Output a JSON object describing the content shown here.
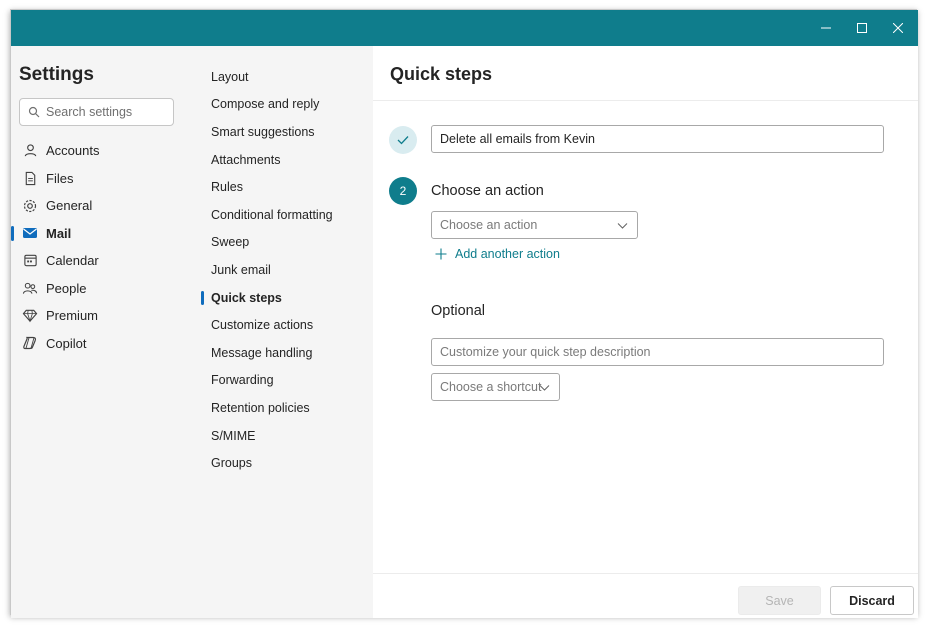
{
  "window": {
    "controls": {
      "minimize_icon": "minimize-icon",
      "maximize_icon": "maximize-icon",
      "close_icon": "close-icon"
    }
  },
  "settings_nav": {
    "title": "Settings",
    "search": {
      "placeholder": "Search settings"
    },
    "items": [
      {
        "label": "Accounts",
        "icon": "person-icon",
        "active": false
      },
      {
        "label": "Files",
        "icon": "document-icon",
        "active": false
      },
      {
        "label": "General",
        "icon": "gear-icon",
        "active": false
      },
      {
        "label": "Mail",
        "icon": "mail-icon",
        "active": true
      },
      {
        "label": "Calendar",
        "icon": "calendar-icon",
        "active": false
      },
      {
        "label": "People",
        "icon": "people-icon",
        "active": false
      },
      {
        "label": "Premium",
        "icon": "diamond-icon",
        "active": false
      },
      {
        "label": "Copilot",
        "icon": "copilot-icon",
        "active": false
      }
    ]
  },
  "mail_nav": {
    "items": [
      {
        "label": "Layout"
      },
      {
        "label": "Compose and reply"
      },
      {
        "label": "Smart suggestions"
      },
      {
        "label": "Attachments"
      },
      {
        "label": "Rules"
      },
      {
        "label": "Conditional formatting"
      },
      {
        "label": "Sweep"
      },
      {
        "label": "Junk email"
      },
      {
        "label": "Quick steps",
        "active": true
      },
      {
        "label": "Customize actions"
      },
      {
        "label": "Message handling"
      },
      {
        "label": "Forwarding"
      },
      {
        "label": "Retention policies"
      },
      {
        "label": "S/MIME"
      },
      {
        "label": "Groups"
      }
    ]
  },
  "main": {
    "title": "Quick steps",
    "step1": {
      "name_value": "Delete all emails from Kevin",
      "icon": "check-icon"
    },
    "step2": {
      "number": "2",
      "label": "Choose an action",
      "action_dropdown": "Choose an action",
      "add_action_label": "Add another action"
    },
    "optional": {
      "label": "Optional",
      "description_placeholder": "Customize your quick step description",
      "shortcut_dropdown": "Choose a shortcut"
    },
    "footer": {
      "save_label": "Save",
      "discard_label": "Discard",
      "save_enabled": false
    }
  },
  "colors": {
    "titlebar": "#0f7d8c",
    "accent": "#0f7d8c",
    "active_indicator": "#0f6cbd"
  }
}
